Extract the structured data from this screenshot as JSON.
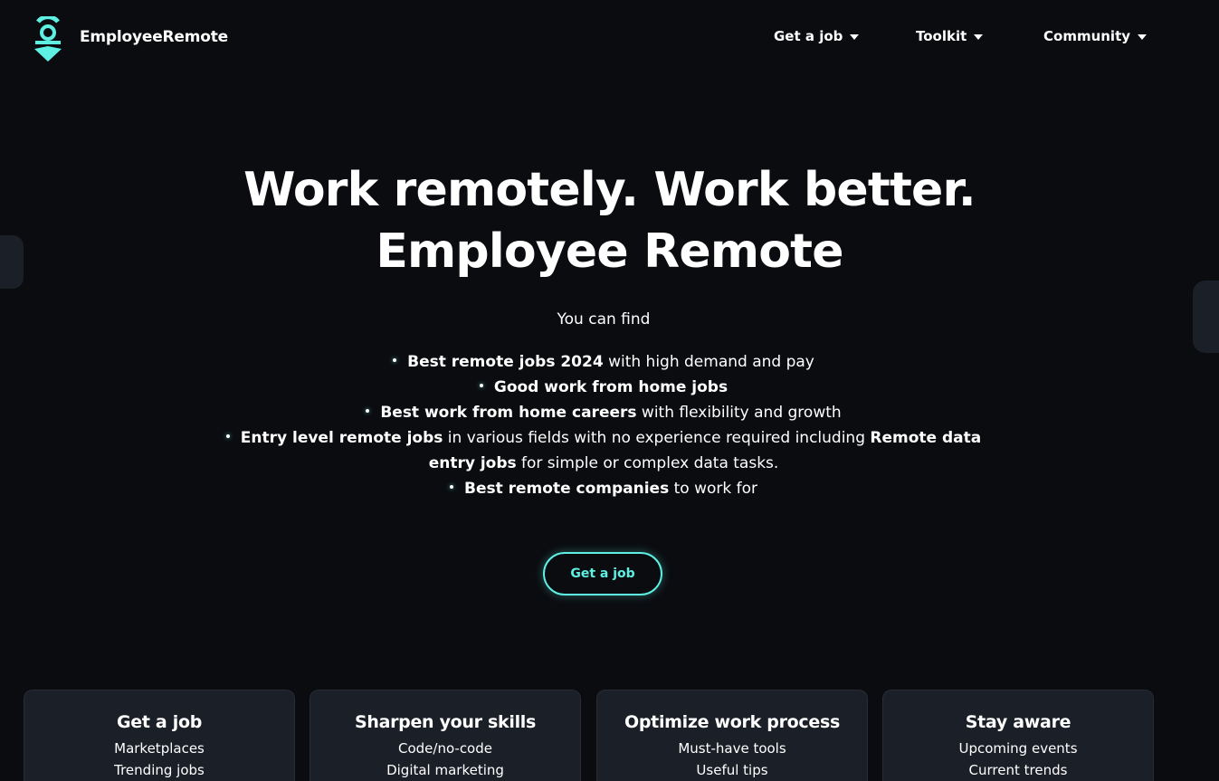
{
  "header": {
    "brand": "EmployeeRemote",
    "nav": [
      {
        "label": "Get a job"
      },
      {
        "label": "Toolkit"
      },
      {
        "label": "Community"
      }
    ]
  },
  "hero": {
    "title_line1": "Work remotely. Work better.",
    "title_line2": "Employee Remote",
    "intro": "You can find",
    "bullets": [
      {
        "bold": "Best remote jobs 2024",
        "rest": " with high demand and pay"
      },
      {
        "bold": "Good work from home jobs",
        "rest": ""
      },
      {
        "bold": "Best work from home careers",
        "rest": " with flexibility and growth"
      },
      {
        "bold": "Entry level remote jobs",
        "rest": " in various fields with no experience required including ",
        "bold2": "Remote data entry jobs",
        "rest2": " for simple or complex data tasks."
      },
      {
        "bold": "Best remote companies",
        "rest": " to work for"
      }
    ],
    "cta_label": "Get a job"
  },
  "cards": [
    {
      "title": "Get a job",
      "items": [
        "Marketplaces",
        "Trending jobs"
      ]
    },
    {
      "title": "Sharpen your skills",
      "items": [
        "Code/no-code",
        "Digital marketing"
      ]
    },
    {
      "title": "Optimize work process",
      "items": [
        "Must-have tools",
        "Useful tips"
      ]
    },
    {
      "title": "Stay aware",
      "items": [
        "Upcoming events",
        "Current trends"
      ]
    }
  ],
  "colors": {
    "background": "#0b0c10",
    "accent": "#5ef0e2",
    "card": "#1b1f27"
  }
}
